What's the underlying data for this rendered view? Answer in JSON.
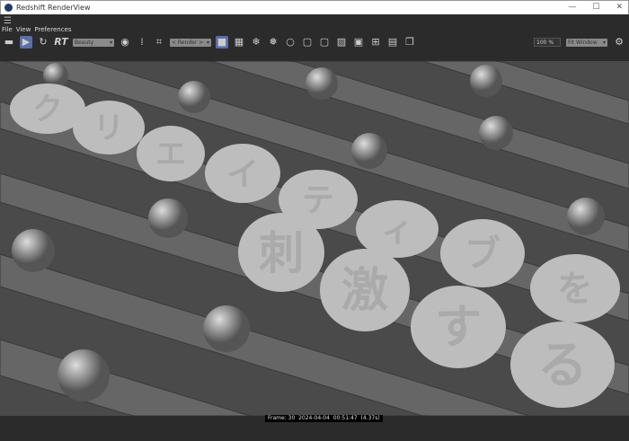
{
  "window": {
    "title": "Redshift RenderView",
    "minimize": "—",
    "maximize": "☐",
    "close": "✕"
  },
  "menu": [
    "File",
    "View",
    "Preferences"
  ],
  "toolbar": {
    "rt_label": "RT",
    "aov": "Beauty",
    "camera": "< Render >",
    "zoom": "100 %",
    "fit": "Fit Window"
  },
  "status": "Frame: 30  2024-04-04  00:51:47  (4.37s)",
  "render": {
    "coins": [
      "ク",
      "リ",
      "エ",
      "イ",
      "テ",
      "ィ",
      "ブ",
      "を",
      "刺",
      "激",
      "す",
      "る"
    ]
  },
  "colors": {
    "accent": "#5a6fa8"
  }
}
